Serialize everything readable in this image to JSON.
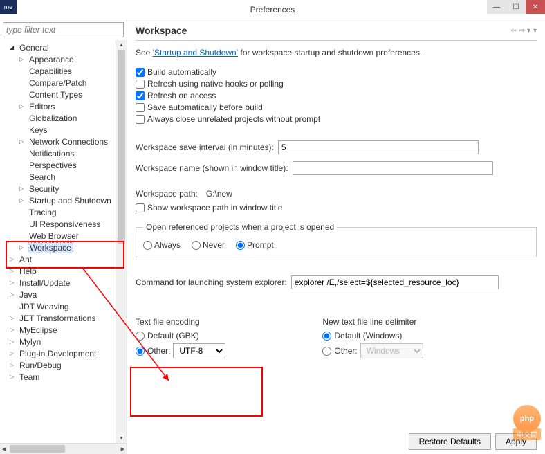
{
  "window": {
    "title": "Preferences",
    "logo": "me"
  },
  "sidebar": {
    "filter_placeholder": "type filter text",
    "items": [
      {
        "label": "General",
        "level": 1,
        "arrow": "open"
      },
      {
        "label": "Appearance",
        "level": 2,
        "arrow": "closed"
      },
      {
        "label": "Capabilities",
        "level": 2,
        "arrow": ""
      },
      {
        "label": "Compare/Patch",
        "level": 2,
        "arrow": ""
      },
      {
        "label": "Content Types",
        "level": 2,
        "arrow": ""
      },
      {
        "label": "Editors",
        "level": 2,
        "arrow": "closed"
      },
      {
        "label": "Globalization",
        "level": 2,
        "arrow": ""
      },
      {
        "label": "Keys",
        "level": 2,
        "arrow": ""
      },
      {
        "label": "Network Connections",
        "level": 2,
        "arrow": "closed"
      },
      {
        "label": "Notifications",
        "level": 2,
        "arrow": ""
      },
      {
        "label": "Perspectives",
        "level": 2,
        "arrow": ""
      },
      {
        "label": "Search",
        "level": 2,
        "arrow": ""
      },
      {
        "label": "Security",
        "level": 2,
        "arrow": "closed"
      },
      {
        "label": "Startup and Shutdown",
        "level": 2,
        "arrow": "closed"
      },
      {
        "label": "Tracing",
        "level": 2,
        "arrow": ""
      },
      {
        "label": "UI Responsiveness",
        "level": 2,
        "arrow": ""
      },
      {
        "label": "Web Browser",
        "level": 2,
        "arrow": ""
      },
      {
        "label": "Workspace",
        "level": 2,
        "arrow": "closed",
        "selected": true
      },
      {
        "label": "Ant",
        "level": 1,
        "arrow": "closed"
      },
      {
        "label": "Help",
        "level": 1,
        "arrow": "closed"
      },
      {
        "label": "Install/Update",
        "level": 1,
        "arrow": "closed"
      },
      {
        "label": "Java",
        "level": 1,
        "arrow": "closed"
      },
      {
        "label": "JDT Weaving",
        "level": 1,
        "arrow": ""
      },
      {
        "label": "JET Transformations",
        "level": 1,
        "arrow": "closed"
      },
      {
        "label": "MyEclipse",
        "level": 1,
        "arrow": "closed"
      },
      {
        "label": "Mylyn",
        "level": 1,
        "arrow": "closed"
      },
      {
        "label": "Plug-in Development",
        "level": 1,
        "arrow": "closed"
      },
      {
        "label": "Run/Debug",
        "level": 1,
        "arrow": "closed"
      },
      {
        "label": "Team",
        "level": 1,
        "arrow": "closed"
      }
    ]
  },
  "page": {
    "title": "Workspace",
    "intro_pre": "See ",
    "intro_link": "'Startup and Shutdown'",
    "intro_post": " for workspace startup and shutdown preferences.",
    "checks": {
      "build_auto": "Build automatically",
      "refresh_hooks": "Refresh using native hooks or polling",
      "refresh_access": "Refresh on access",
      "save_auto": "Save automatically before build",
      "close_unrelated": "Always close unrelated projects without prompt"
    },
    "save_interval_label": "Workspace save interval (in minutes):",
    "save_interval_value": "5",
    "ws_name_label": "Workspace name (shown in window title):",
    "ws_name_value": "",
    "ws_path_label": "Workspace path:",
    "ws_path_value": "G:\\new",
    "show_path": "Show workspace path in window title",
    "open_ref_legend": "Open referenced projects when a project is opened",
    "open_ref": {
      "always": "Always",
      "never": "Never",
      "prompt": "Prompt"
    },
    "explorer_label": "Command for launching system explorer:",
    "explorer_value": "explorer /E,/select=${selected_resource_loc}",
    "encoding": {
      "title": "Text file encoding",
      "default": "Default (GBK)",
      "other": "Other:",
      "other_value": "UTF-8"
    },
    "delimiter": {
      "title": "New text file line delimiter",
      "default": "Default (Windows)",
      "other": "Other:",
      "other_value": "Windows"
    },
    "buttons": {
      "restore": "Restore Defaults",
      "apply": "Apply"
    }
  },
  "watermark": {
    "badge": "php",
    "text": "中文网"
  }
}
